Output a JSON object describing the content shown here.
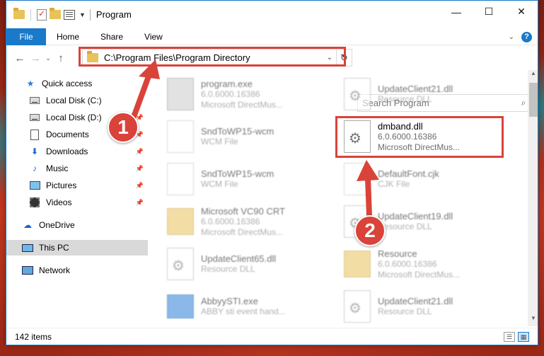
{
  "window": {
    "title": "Program"
  },
  "ribbon": {
    "tabs": [
      "File",
      "Home",
      "Share",
      "View"
    ],
    "help": "?"
  },
  "address": {
    "path": "C:\\Program Files\\Program Directory",
    "search_placeholder": "Search Program"
  },
  "sidebar": {
    "items": [
      {
        "label": "Quick access",
        "icon": "star-icon",
        "pinned": false
      },
      {
        "label": "Local Disk (C:)",
        "icon": "drive-icon",
        "pinned": true
      },
      {
        "label": "Local Disk (D:)",
        "icon": "drive-icon",
        "pinned": true
      },
      {
        "label": "Documents",
        "icon": "documents-icon",
        "pinned": true
      },
      {
        "label": "Downloads",
        "icon": "downloads-icon",
        "pinned": true
      },
      {
        "label": "Music",
        "icon": "music-icon",
        "pinned": true
      },
      {
        "label": "Pictures",
        "icon": "pictures-icon",
        "pinned": true
      },
      {
        "label": "Videos",
        "icon": "videos-icon",
        "pinned": true
      },
      {
        "label": "OneDrive",
        "icon": "onedrive-icon",
        "pinned": false
      },
      {
        "label": "This PC",
        "icon": "this-pc-icon",
        "pinned": false,
        "selected": true
      },
      {
        "label": "Network",
        "icon": "network-icon",
        "pinned": false
      }
    ]
  },
  "files": {
    "left": [
      {
        "name": "program.exe",
        "line1": "6.0.6000.16386",
        "line2": "Microsoft DirectMus...",
        "icon": "exe"
      },
      {
        "name": "SndToWP15-wcm",
        "line1": "WCM File",
        "line2": "",
        "icon": "blank"
      },
      {
        "name": "SndToWP15-wcm",
        "line1": "WCM File",
        "line2": "",
        "icon": "blank"
      },
      {
        "name": "Microsoft VC90 CRT",
        "line1": "6.0.6000.16386",
        "line2": "Microsoft DirectMus...",
        "icon": "folder"
      },
      {
        "name": "UpdateClient65.dll",
        "line1": "Resource DLL",
        "line2": "",
        "icon": "dll"
      },
      {
        "name": "AbbyySTI.exe",
        "line1": "ABBY sti event hand...",
        "line2": "",
        "icon": "exe-blue"
      }
    ],
    "right": [
      {
        "name": "UpdateClient21.dll",
        "line1": "Resource DLL",
        "line2": "",
        "icon": "dll"
      },
      {
        "name": "dmband.dll",
        "line1": "6.0.6000.16386",
        "line2": "Microsoft DirectMus...",
        "icon": "dll",
        "highlight": true
      },
      {
        "name": "DefaultFont.cjk",
        "line1": "CJK File",
        "line2": "",
        "icon": "blank"
      },
      {
        "name": "UpdateClient19.dll",
        "line1": "Resource DLL",
        "line2": "",
        "icon": "dll"
      },
      {
        "name": "Resource",
        "line1": "6.0.6000.16386",
        "line2": "Microsoft DirectMus...",
        "icon": "folder"
      },
      {
        "name": "UpdateClient21.dll",
        "line1": "Resource DLL",
        "line2": "",
        "icon": "dll"
      }
    ]
  },
  "status": {
    "count": "142 items"
  },
  "annotations": {
    "badge1": "1",
    "badge2": "2",
    "color": "#d9433a"
  }
}
